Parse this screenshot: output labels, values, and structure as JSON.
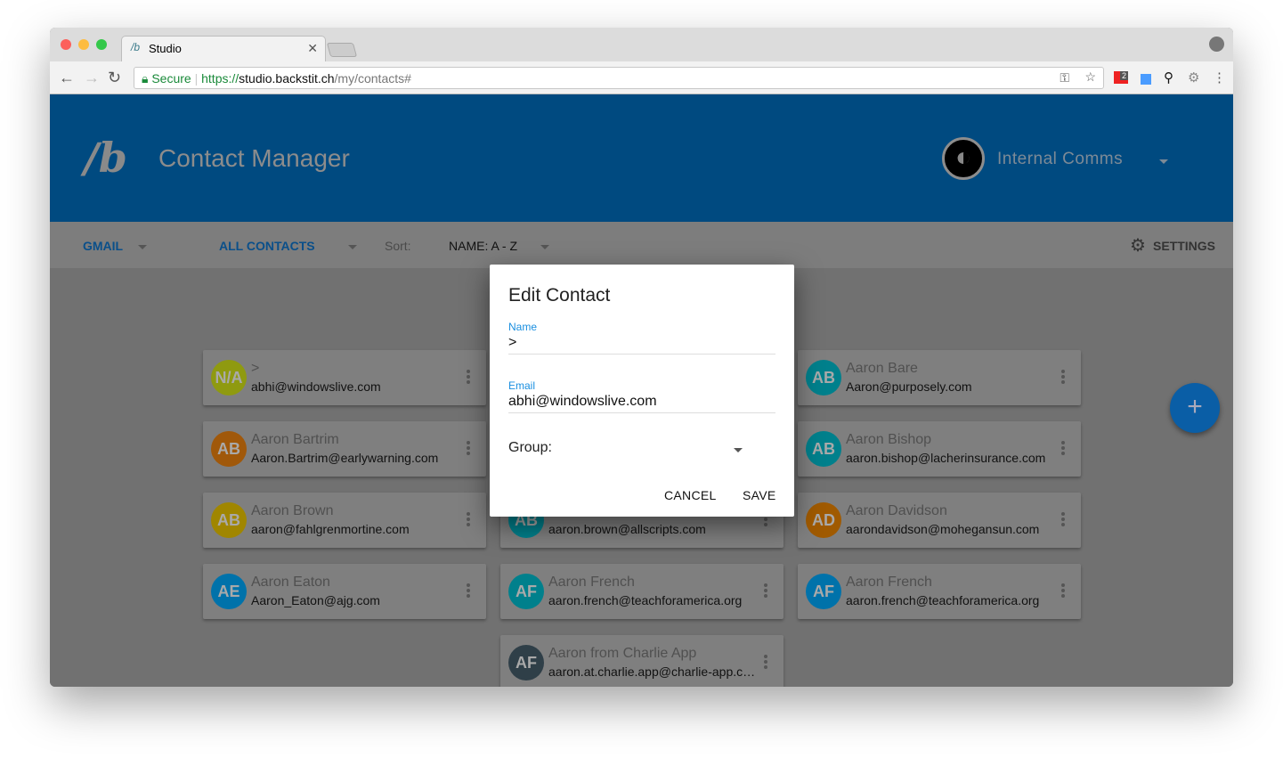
{
  "browser": {
    "tab_title": "Studio",
    "secure_label": "Secure",
    "url_scheme": "https://",
    "url_host": "studio.backstit.ch",
    "url_path": "/my/contacts#",
    "ext_badge": "2"
  },
  "header": {
    "title": "Contact Manager",
    "org_name": "Internal Comms"
  },
  "toolbar": {
    "account": "GMAIL",
    "filter": "ALL CONTACTS",
    "sort_label": "Sort:",
    "sort_value": "NAME: A - Z",
    "settings": "SETTINGS"
  },
  "colors": {
    "header": "#004a80",
    "accent": "#1a8fe0"
  },
  "contacts": [
    {
      "initials": "N/A",
      "name": ">",
      "email": "abhi@windowslive.com",
      "color": "#8f9a10"
    },
    {
      "initials": "AB",
      "name": "Aaron Bare",
      "email": "Aaron@purposely.com",
      "color": "#00808c"
    },
    {
      "initials": "AB",
      "name": "Aaron Bartrim",
      "email": "Aaron.Bartrim@earlywarning.com",
      "color": "#a0580a"
    },
    {
      "initials": "AB",
      "name": "Aaron Bishop",
      "email": "aaron.bishop@lacherinsurance.com",
      "color": "#00808c"
    },
    {
      "initials": "AB",
      "name": "Aaron Brown",
      "email": "aaron@fahlgrenmortine.com",
      "color": "#a08600"
    },
    {
      "initials": "AB",
      "name": "",
      "email": "aaron.brown@allscripts.com",
      "color": "#00808c"
    },
    {
      "initials": "AD",
      "name": "Aaron Davidson",
      "email": "aarondavidson@mohegansun.com",
      "color": "#a05a00"
    },
    {
      "initials": "AE",
      "name": "Aaron Eaton",
      "email": "Aaron_Eaton@ajg.com",
      "color": "#0072aa"
    },
    {
      "initials": "AF",
      "name": "Aaron French",
      "email": "aaron.french@teachforamerica.org",
      "color": "#00808c"
    },
    {
      "initials": "AF",
      "name": "Aaron French",
      "email": "aaron.french@teachforamerica.org",
      "color": "#0072aa"
    },
    {
      "initials": "AF",
      "name": "Aaron from Charlie App",
      "email": "aaron.at.charlie.app@charlie-app.com",
      "color": "#2f3f48"
    }
  ],
  "fab": {
    "label": "+"
  },
  "dialog": {
    "title": "Edit Contact",
    "name_label": "Name",
    "name_value": ">",
    "email_label": "Email",
    "email_value": "abhi@windowslive.com",
    "group_label": "Group:",
    "cancel": "CANCEL",
    "save": "SAVE"
  }
}
